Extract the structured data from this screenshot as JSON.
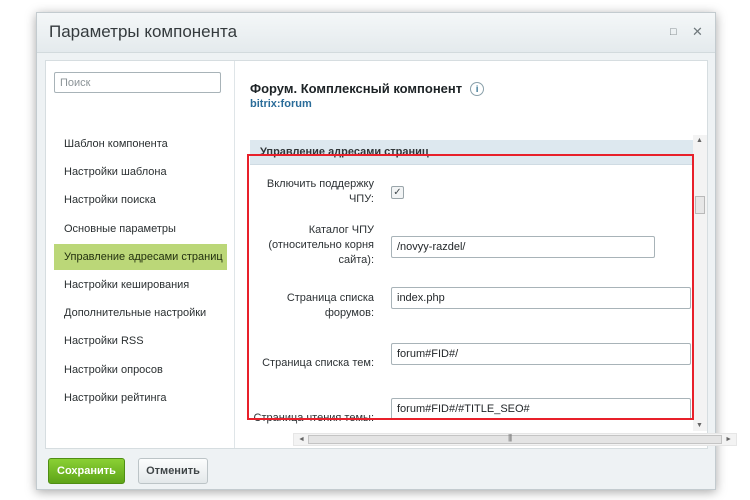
{
  "dialog": {
    "title": "Параметры компонента",
    "maximize_glyph": "□",
    "close_glyph": "✕"
  },
  "search": {
    "placeholder": "Поиск",
    "value": ""
  },
  "sidebar": {
    "items": [
      {
        "label": "Шаблон компонента",
        "active": false
      },
      {
        "label": "Настройки шаблона",
        "active": false
      },
      {
        "label": "Настройки поиска",
        "active": false
      },
      {
        "label": "Основные параметры",
        "active": false
      },
      {
        "label": "Управление адресами страниц",
        "active": true
      },
      {
        "label": "Настройки кеширования",
        "active": false
      },
      {
        "label": "Дополнительные настройки",
        "active": false
      },
      {
        "label": "Настройки RSS",
        "active": false
      },
      {
        "label": "Настройки опросов",
        "active": false
      },
      {
        "label": "Настройки рейтинга",
        "active": false
      }
    ]
  },
  "component": {
    "title": "Форум. Комплексный компонент",
    "info_icon": "i",
    "code": "bitrix:forum"
  },
  "section": {
    "title": "Управление адресами страниц"
  },
  "form": {
    "sef": {
      "label": "Включить поддержку ЧПУ:",
      "checked": true,
      "check_glyph": "✓"
    },
    "sef_folder": {
      "label": "Каталог ЧПУ (относительно корня сайта):",
      "value": "/novyy-razdel/"
    },
    "forums_list": {
      "label": "Страница списка форумов:",
      "value": "index.php"
    },
    "topics_list": {
      "label": "Страница списка тем:",
      "value": "forum#FID#/"
    },
    "topic_read": {
      "label": "Страница чтения темы:",
      "value": "forum#FID#/#TITLE_SEO#"
    }
  },
  "scrollbars": {
    "up": "▲",
    "down": "▼",
    "left": "◄",
    "right": "►",
    "grip": "|||"
  },
  "footer": {
    "save_label": "Сохранить",
    "cancel_label": "Отменить"
  },
  "colors": {
    "active_item": "#bbd778",
    "save_button": "#6db324",
    "highlight_border": "#e8202a",
    "link": "#2a6c99"
  }
}
